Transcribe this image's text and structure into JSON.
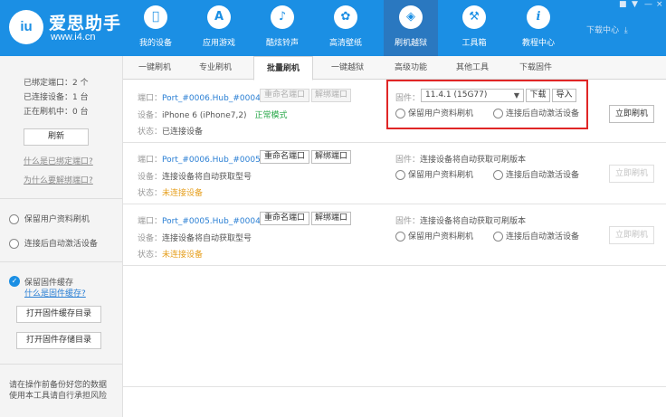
{
  "app": {
    "title": "爱思助手",
    "url": "www.i4.cn",
    "logo_text": "iu"
  },
  "nav": [
    {
      "label": "我的设备",
      "icon": "apple-icon",
      "glyph": ""
    },
    {
      "label": "应用游戏",
      "icon": "app-store-icon",
      "glyph": "A"
    },
    {
      "label": "酷炫铃声",
      "icon": "bell-icon",
      "glyph": "♪"
    },
    {
      "label": "高清壁纸",
      "icon": "flower-icon",
      "glyph": "✿"
    },
    {
      "label": "刷机越狱",
      "icon": "dropbox-icon",
      "glyph": "◈"
    },
    {
      "label": "工具箱",
      "icon": "tools-icon",
      "glyph": "⚒"
    },
    {
      "label": "教程中心",
      "icon": "info-icon",
      "glyph": "i"
    }
  ],
  "header_right": {
    "download_center": "下载中心"
  },
  "sidebar": {
    "bound_ports": "已绑定端口：2 个",
    "connected_devices": "已连接设备：1 台",
    "flashing": "正在刷机中：0 台",
    "refresh": "刷新",
    "link_what_bound": "什么是已绑定端口?",
    "link_why_unbind": "为什么要解绑端口?",
    "opt_keep_data": "保留用户资料刷机",
    "opt_auto_activate": "连接后自动激活设备",
    "opt_keep_cache": "保留固件缓存",
    "link_what_cache": "什么是固件缓存?",
    "btn_open_cache": "打开固件缓存目录",
    "btn_open_storage": "打开固件存储目录",
    "footer_1": "请在操作前备份好您的数据",
    "footer_2": "使用本工具请自行承担风险"
  },
  "tabs": [
    "一键刷机",
    "专业刷机",
    "批量刷机",
    "一键越狱",
    "高级功能",
    "其他工具",
    "下载固件"
  ],
  "active_tab": "批量刷机",
  "labels": {
    "port": "端口：",
    "device": "设备：",
    "status": "状态：",
    "firmware": "固件：",
    "rename": "重命名端口",
    "unbind": "解绑端口",
    "download": "下载",
    "import": "导入",
    "flash_now": "立即刷机"
  },
  "rows": [
    {
      "port": "Port_#0006.Hub_#0004",
      "device": "iPhone 6 (iPhone7,2)",
      "device_mode": "正常模式",
      "status": "已连接设备",
      "firmware": "11.4.1 (15G77)",
      "opt_keep_data": "保留用户资料刷机",
      "opt_auto_activate": "连接后自动激活设备"
    },
    {
      "port": "Port_#0006.Hub_#0005",
      "device": "连接设备将自动获取型号",
      "status": "未连接设备",
      "firmware": "连接设备将自动获取可刷版本",
      "opt_keep_data": "保留用户资料刷机",
      "opt_auto_activate": "连接后自动激活设备"
    },
    {
      "port": "Port_#0005.Hub_#0004",
      "device": "连接设备将自动获取型号",
      "status": "未连接设备",
      "firmware": "连接设备将自动获取可刷版本",
      "opt_keep_data": "保留用户资料刷机",
      "opt_auto_activate": "连接后自动激活设备"
    }
  ],
  "colors": {
    "brand": "#1b8fe4",
    "link": "#2a7fd4",
    "ok": "#2aa84a",
    "warn": "#e6a020",
    "highlight": "#e02626"
  }
}
